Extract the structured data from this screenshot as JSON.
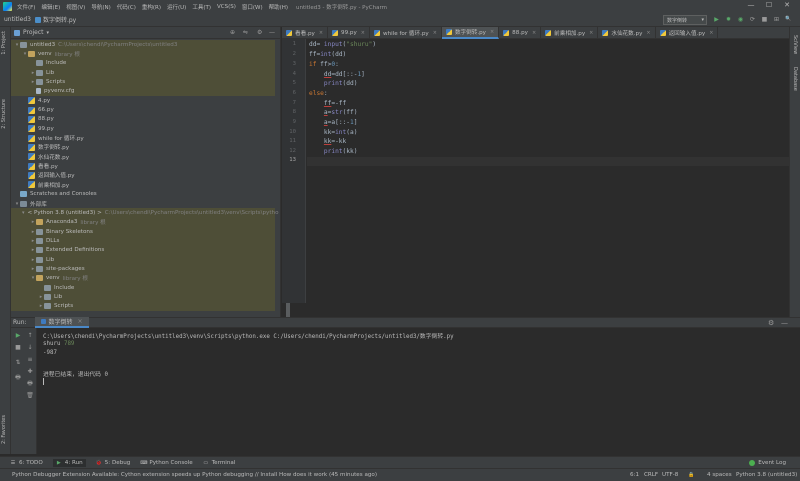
{
  "menubar": {
    "items": [
      "文件(F)",
      "编辑(E)",
      "视图(V)",
      "导航(N)",
      "代码(C)",
      "重构(R)",
      "运行(U)",
      "工具(T)",
      "VCS(S)",
      "窗口(W)",
      "帮助(H)"
    ],
    "title": "untitled3 - 数字倒转.py - PyCharm",
    "win_buttons": [
      "—",
      "☐",
      "✕"
    ]
  },
  "navbar": {
    "project": "untitled3",
    "file": "数字倒转.py",
    "run_config": "数字倒转",
    "run_config_arrow": "▾",
    "toolbar_icons": [
      "▶",
      "✹",
      "◉",
      "⟳",
      "■",
      "⊞",
      "🔍"
    ]
  },
  "left_strip": {
    "project": "1: Project",
    "structure": "2: Structure",
    "favorites": "2: Favorites"
  },
  "right_strip": {
    "scview": "SciView",
    "database": "Database"
  },
  "project_panel": {
    "header": "Project",
    "header_arrow": "▾",
    "header_icons": [
      "⊕",
      "⇋",
      "⚙",
      "—"
    ],
    "tree": [
      {
        "level": 0,
        "arrow": "▾",
        "icon": "folder",
        "label": "untitled3",
        "note": "C:\\Users\\chendi\\PycharmProjects\\untitled3",
        "hl": true
      },
      {
        "level": 1,
        "arrow": "▾",
        "icon": "folder-lib",
        "label": "venv",
        "note": "library 根",
        "hl": true
      },
      {
        "level": 2,
        "arrow": "",
        "icon": "folder",
        "label": "Include",
        "note": "",
        "hl": true
      },
      {
        "level": 2,
        "arrow": "▸",
        "icon": "folder",
        "label": "Lib",
        "note": "",
        "hl": true
      },
      {
        "level": 2,
        "arrow": "▸",
        "icon": "folder",
        "label": "Scripts",
        "note": "",
        "hl": true
      },
      {
        "level": 2,
        "arrow": "",
        "icon": "file",
        "label": "pyvenv.cfg",
        "note": "",
        "hl": true
      },
      {
        "level": 1,
        "arrow": "",
        "icon": "py",
        "label": "4.py",
        "note": "",
        "hl": false
      },
      {
        "level": 1,
        "arrow": "",
        "icon": "py",
        "label": "66.py",
        "note": "",
        "hl": false
      },
      {
        "level": 1,
        "arrow": "",
        "icon": "py",
        "label": "88.py",
        "note": "",
        "hl": false
      },
      {
        "level": 1,
        "arrow": "",
        "icon": "py",
        "label": "99.py",
        "note": "",
        "hl": false
      },
      {
        "level": 1,
        "arrow": "",
        "icon": "py",
        "label": "while for 循环.py",
        "note": "",
        "hl": false
      },
      {
        "level": 1,
        "arrow": "",
        "icon": "py",
        "label": "数字倒转.py",
        "note": "",
        "hl": false
      },
      {
        "level": 1,
        "arrow": "",
        "icon": "py",
        "label": "水仙花数.py",
        "note": "",
        "hl": false
      },
      {
        "level": 1,
        "arrow": "",
        "icon": "py",
        "label": "看看.py",
        "note": "",
        "hl": false
      },
      {
        "level": 1,
        "arrow": "",
        "icon": "py",
        "label": "返回输入值.py",
        "note": "",
        "hl": false
      },
      {
        "level": 1,
        "arrow": "",
        "icon": "py",
        "label": "前乘相加.py",
        "note": "",
        "hl": false
      },
      {
        "level": 0,
        "arrow": "",
        "icon": "scratch",
        "label": "Scratches and Consoles",
        "note": "",
        "hl": false
      },
      {
        "level": 0,
        "arrow": "▾",
        "icon": "lib",
        "label": "外部库",
        "note": "",
        "hl": false
      },
      {
        "level": 1,
        "arrow": "▾",
        "icon": "python",
        "label": "< Python 3.8 (untitled3) >",
        "note": "C:\\Users\\chendi\\PycharmProjects\\untitled3\\venv\\Scripts\\pytho",
        "hl": true
      },
      {
        "level": 2,
        "arrow": "▸",
        "icon": "folder-lib",
        "label": "Anaconda3",
        "note": "library 根",
        "hl": true
      },
      {
        "level": 2,
        "arrow": "▸",
        "icon": "folder",
        "label": "Binary Skeletons",
        "note": "",
        "hl": true
      },
      {
        "level": 2,
        "arrow": "▸",
        "icon": "folder",
        "label": "DLLs",
        "note": "",
        "hl": true
      },
      {
        "level": 2,
        "arrow": "▸",
        "icon": "folder",
        "label": "Extended Definitions",
        "note": "",
        "hl": true
      },
      {
        "level": 2,
        "arrow": "▸",
        "icon": "folder",
        "label": "Lib",
        "note": "",
        "hl": true
      },
      {
        "level": 2,
        "arrow": "▸",
        "icon": "folder",
        "label": "site-packages",
        "note": "",
        "hl": true
      },
      {
        "level": 2,
        "arrow": "▾",
        "icon": "folder-lib",
        "label": "venv",
        "note": "library 根",
        "hl": true
      },
      {
        "level": 3,
        "arrow": "",
        "icon": "folder",
        "label": "Include",
        "note": "",
        "hl": true
      },
      {
        "level": 3,
        "arrow": "▸",
        "icon": "folder",
        "label": "Lib",
        "note": "",
        "hl": true
      },
      {
        "level": 3,
        "arrow": "▸",
        "icon": "folder",
        "label": "Scripts",
        "note": "",
        "hl": true
      }
    ]
  },
  "editor": {
    "tabs": [
      {
        "label": "看看.py",
        "active": false
      },
      {
        "label": "99.py",
        "active": false
      },
      {
        "label": "while for 循环.py",
        "active": false
      },
      {
        "label": "数字倒转.py",
        "active": true
      },
      {
        "label": "88.py",
        "active": false
      },
      {
        "label": "前乘相加.py",
        "active": false
      },
      {
        "label": "水仙花数.py",
        "active": false
      },
      {
        "label": "返回输入值.py",
        "active": false
      }
    ],
    "tab_close": "×",
    "line_numbers": [
      "1",
      "2",
      "3",
      "4",
      "5",
      "6",
      "7",
      "8",
      "9",
      "10",
      "11",
      "12",
      "13"
    ],
    "current_line": 13
  },
  "run_panel": {
    "label": "Run:",
    "tab": "数字倒转",
    "tab_close": "×",
    "gear": "⚙",
    "minimize": "—",
    "console": {
      "command": "C:\\Users\\chendi\\PycharmProjects\\untitled3\\venv\\Scripts\\python.exe C:/Users/chendi/PycharmProjects/untitled3/数字倒转.py",
      "prompt": "shuru ",
      "input": "789",
      "output": "-987",
      "exit": "进程已结束，退出代码 0"
    },
    "tool_icons": [
      "▶",
      "↑",
      "■",
      "↓",
      "≡",
      "⇅",
      "✚",
      "🖶",
      "🗑"
    ]
  },
  "bottom_tabs": [
    {
      "icon": "☰",
      "label": "6: TODO",
      "active": false
    },
    {
      "icon": "▶",
      "label": "4: Run",
      "active": true
    },
    {
      "icon": "🐞",
      "label": "5: Debug",
      "active": false
    },
    {
      "icon": "⌨",
      "label": "Python Console",
      "active": false
    },
    {
      "icon": "▭",
      "label": "Terminal",
      "active": false
    }
  ],
  "event_log": "Event Log",
  "statusbar": {
    "message": "Python Debugger Extension Available: Cython extension speeds up Python debugging // Install   How does it work (45 minutes ago)",
    "position": "6:1",
    "line_sep": "CRLF",
    "encoding": "UTF-8",
    "indent": "4 spaces",
    "interpreter": "Python 3.8 (untitled3)",
    "lock": "🔒"
  },
  "colors": {
    "bg_dark": "#2b2b2b",
    "panel": "#3c3f41",
    "keyword": "#cc7832",
    "string": "#6a8759",
    "number": "#6897bb",
    "builtin": "#8888c6",
    "active_tab_accent": "#4a88c7",
    "row_highlight": "#4e4e37"
  }
}
